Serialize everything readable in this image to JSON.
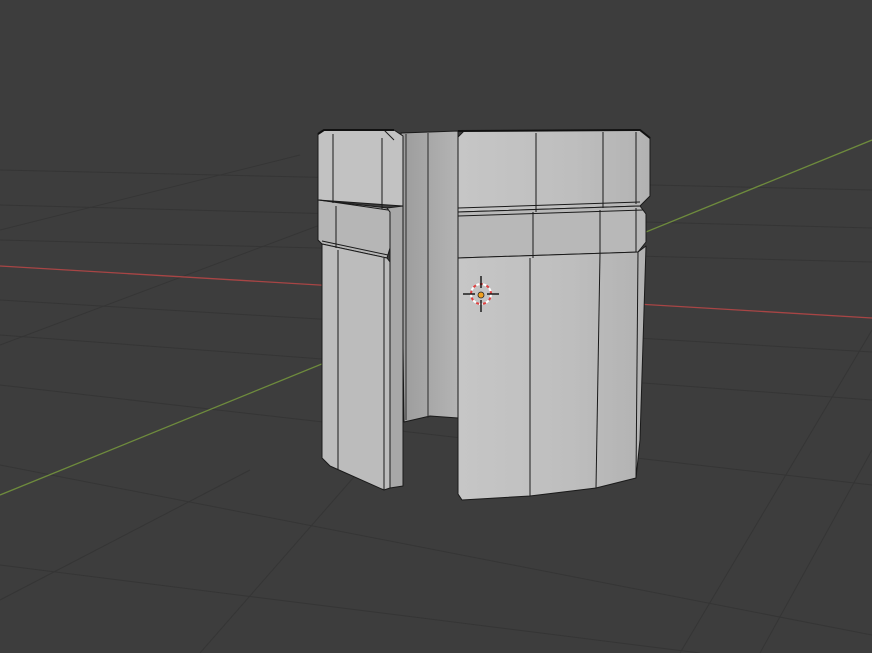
{
  "viewport": {
    "view": "3d-viewport",
    "shading": "solid",
    "background_color": "#3d3d3d",
    "grid_color": "#353535",
    "x_axis_color": "#a84545",
    "y_axis_color": "#6e8b3d",
    "mesh_face_color": "#bdbdbd",
    "mesh_edge_color": "#1a1a1a"
  },
  "scene": {
    "object_type": "mesh",
    "object_shape": "split-cylinder-clip",
    "has_3d_cursor": true,
    "has_origin_point": true,
    "cursor_colors": [
      "#ffffff",
      "#e04040"
    ],
    "origin_color": "#f0a020"
  }
}
